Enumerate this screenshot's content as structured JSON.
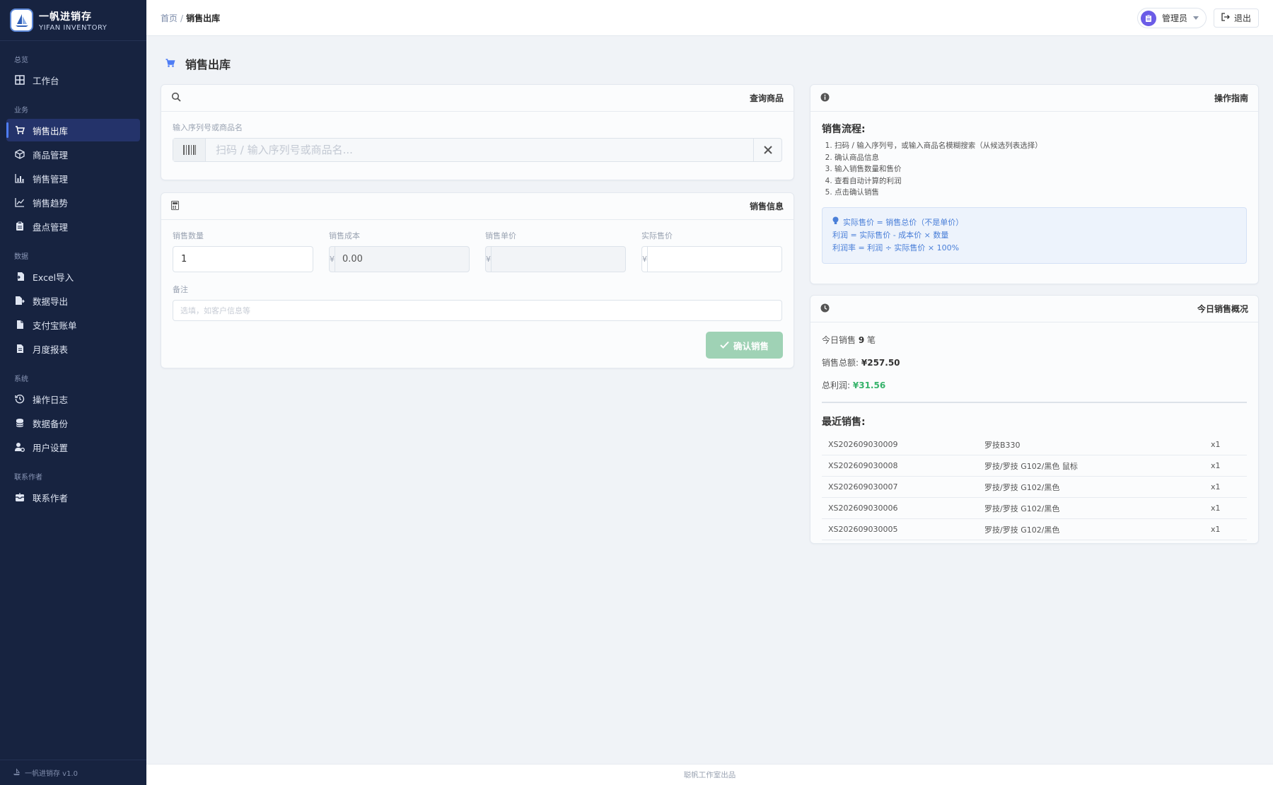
{
  "brand": {
    "name": "一帆进销存",
    "subtitle": "YIFAN INVENTORY"
  },
  "sidebar": {
    "sections": {
      "overview": "总览",
      "business": "业务",
      "data": "数据",
      "system": "系统",
      "contact": "联系作者"
    },
    "items": {
      "workbench": "工作台",
      "sales_out": "销售出库",
      "products": "商品管理",
      "sales_mgmt": "销售管理",
      "sales_trend": "销售趋势",
      "inventory": "盘点管理",
      "excel_import": "Excel导入",
      "data_export": "数据导出",
      "alipay": "支付宝账单",
      "monthly": "月度报表",
      "op_log": "操作日志",
      "backup": "数据备份",
      "user_settings": "用户设置",
      "contact_author": "联系作者"
    },
    "footer": "一帆进销存 v1.0"
  },
  "header": {
    "breadcrumb_home": "首页",
    "breadcrumb_sep": "/",
    "breadcrumb_current": "销售出库",
    "user_name": "管理员",
    "logout_label": "退出"
  },
  "page": {
    "title": "销售出库"
  },
  "query_card": {
    "title": "查询商品",
    "field_label": "输入序列号或商品名",
    "placeholder": "扫码 / 输入序列号或商品名..."
  },
  "sales_card": {
    "title": "销售信息",
    "qty_label": "销售数量",
    "qty_value": "1",
    "cost_label": "销售成本",
    "cost_value": "0.00",
    "unit_price_label": "销售单价",
    "actual_price_label": "实际售价",
    "currency": "¥",
    "remark_label": "备注",
    "remark_placeholder": "选填，如客户信息等",
    "confirm_label": "确认销售"
  },
  "guide_card": {
    "title": "操作指南",
    "flow_title": "销售流程:",
    "steps": [
      "扫码 / 输入序列号，或输入商品名模糊搜索（从候选列表选择）",
      "确认商品信息",
      "输入销售数量和售价",
      "查看自动计算的利润",
      "点击确认销售"
    ],
    "tips": [
      "实际售价 = 销售总价（不是单价）",
      "利润 = 实际售价 - 成本价 × 数量",
      "利润率 = 利润 ÷ 实际售价 × 100%"
    ]
  },
  "today_card": {
    "title": "今日销售概况",
    "count_prefix": "今日销售",
    "count_value": "9",
    "count_suffix": "笔",
    "total_label": "销售总额:",
    "total_value": "¥257.50",
    "profit_label": "总利润:",
    "profit_value": "¥31.56",
    "recent_title": "最近销售:",
    "recent": [
      {
        "id": "XS202609030009",
        "name": "罗技B330",
        "qty": "x1"
      },
      {
        "id": "XS202609030008",
        "name": "罗技/罗技 G102/黑色 鼠标",
        "qty": "x1"
      },
      {
        "id": "XS202609030007",
        "name": "罗技/罗技 G102/黑色",
        "qty": "x1"
      },
      {
        "id": "XS202609030006",
        "name": "罗技/罗技 G102/黑色",
        "qty": "x1"
      },
      {
        "id": "XS202609030005",
        "name": "罗技/罗技 G102/黑色",
        "qty": "x1"
      }
    ]
  },
  "footer": {
    "text": "聪帆工作室出品"
  },
  "colors": {
    "sidebar_bg": "#172340",
    "accent": "#4e7df5",
    "confirm_button": "#9fd2b5",
    "profit": "#37b36b",
    "tip_text": "#4a7fd8"
  }
}
